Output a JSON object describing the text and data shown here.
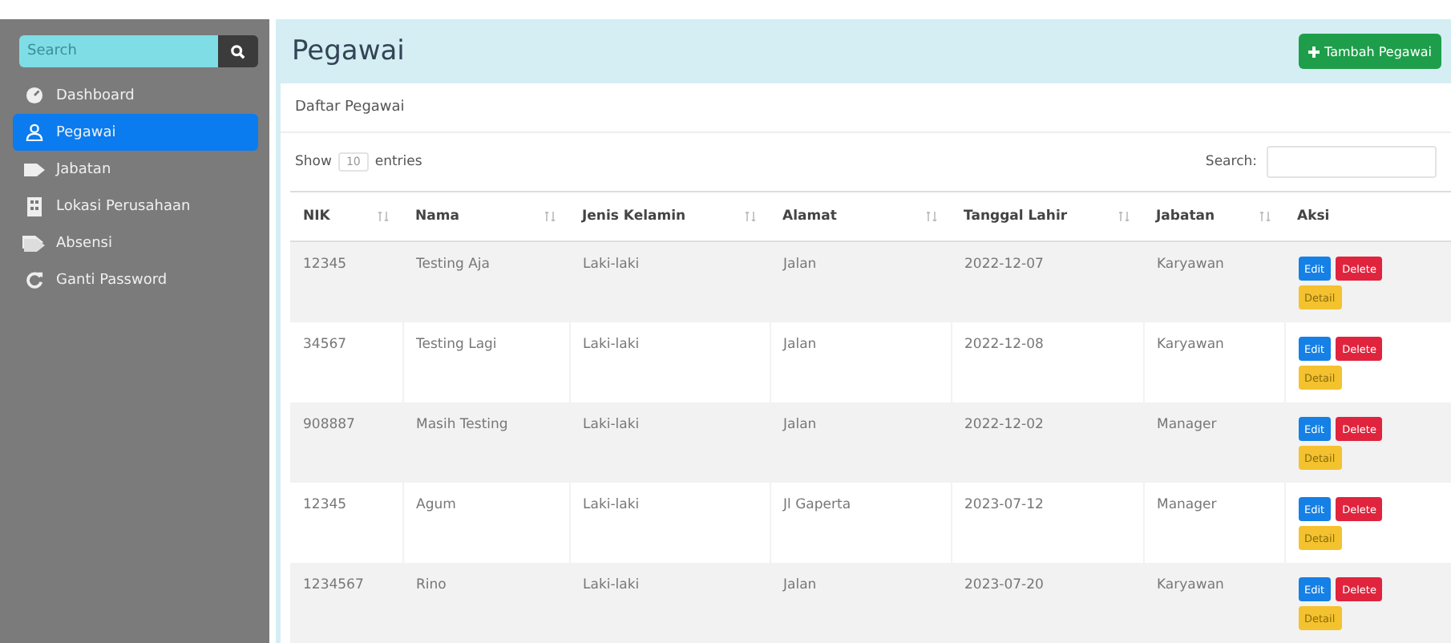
{
  "sidebar": {
    "search": {
      "placeholder": "Search"
    },
    "items": [
      {
        "label": "Dashboard",
        "selected": false
      },
      {
        "label": "Pegawai",
        "selected": true
      },
      {
        "label": "Jabatan",
        "selected": false
      },
      {
        "label": "Lokasi Perusahaan",
        "selected": false
      },
      {
        "label": "Absensi",
        "selected": false
      },
      {
        "label": "Ganti Password",
        "selected": false
      }
    ]
  },
  "header": {
    "title": "Pegawai",
    "button": "Tambah Pegawai"
  },
  "card": {
    "title": "Daftar Pegawai",
    "show_label": "Show",
    "page_size": "10",
    "entries_label": "entries",
    "search_label": "Search:",
    "table": {
      "columns": [
        "NIK",
        "Nama",
        "Jenis Kelamin",
        "Alamat",
        "Tanggal Lahir",
        "Jabatan",
        "Aksi"
      ],
      "rows": [
        {
          "cells": [
            "12345",
            "Testing Aja",
            "Laki-laki",
            "Jalan",
            "2022-12-07",
            "Karyawan"
          ],
          "actions": [
            "Edit",
            "Delete",
            "Detail"
          ]
        },
        {
          "cells": [
            "34567",
            "Testing Lagi",
            "Laki-laki",
            "Jalan",
            "2022-12-08",
            "Karyawan"
          ],
          "actions": [
            "Edit",
            "Delete",
            "Detail"
          ]
        },
        {
          "cells": [
            "908887",
            "Masih Testing",
            "Laki-laki",
            "Jalan",
            "2022-12-02",
            "Manager"
          ],
          "actions": [
            "Edit",
            "Delete",
            "Detail"
          ]
        },
        {
          "cells": [
            "12345",
            "Agum",
            "Laki-laki",
            "Jl Gaperta",
            "2023-07-12",
            "Manager"
          ],
          "actions": [
            "Edit",
            "Delete",
            "Detail"
          ]
        },
        {
          "cells": [
            "1234567",
            "Rino",
            "Laki-laki",
            "Jalan",
            "2023-07-20",
            "Karyawan"
          ],
          "actions": [
            "Edit",
            "Delete",
            "Detail"
          ]
        }
      ]
    }
  }
}
